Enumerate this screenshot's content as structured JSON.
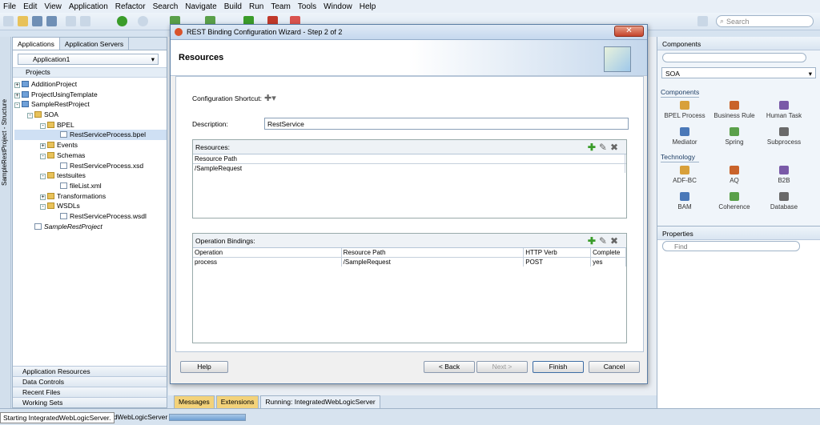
{
  "menu": [
    "File",
    "Edit",
    "View",
    "Application",
    "Refactor",
    "Search",
    "Navigate",
    "Build",
    "Run",
    "Team",
    "Tools",
    "Window",
    "Help"
  ],
  "search": {
    "placeholder": "Search"
  },
  "left_strip": {
    "label": "SampleRestProject - Structure"
  },
  "nav": {
    "tabs": [
      "Applications",
      "Application Servers"
    ],
    "app_selector": "Application1",
    "projects_label": "Projects",
    "tree": [
      {
        "label": "AdditionProject",
        "indent": 0,
        "type": "proj",
        "exp": "+"
      },
      {
        "label": "ProjectUsingTemplate",
        "indent": 0,
        "type": "proj",
        "exp": "+"
      },
      {
        "label": "SampleRestProject",
        "indent": 0,
        "type": "proj",
        "exp": "-"
      },
      {
        "label": "SOA",
        "indent": 1,
        "type": "folder",
        "exp": "-"
      },
      {
        "label": "BPEL",
        "indent": 2,
        "type": "folder",
        "exp": "-"
      },
      {
        "label": "RestServiceProcess.bpel",
        "indent": 3,
        "type": "file",
        "exp": "",
        "selected": true
      },
      {
        "label": "Events",
        "indent": 2,
        "type": "folder",
        "exp": "+"
      },
      {
        "label": "Schemas",
        "indent": 2,
        "type": "folder",
        "exp": "-"
      },
      {
        "label": "RestServiceProcess.xsd",
        "indent": 3,
        "type": "file",
        "exp": ""
      },
      {
        "label": "testsuites",
        "indent": 2,
        "type": "folder",
        "exp": "-"
      },
      {
        "label": "fileList.xml",
        "indent": 3,
        "type": "file",
        "exp": ""
      },
      {
        "label": "Transformations",
        "indent": 2,
        "type": "folder",
        "exp": "+"
      },
      {
        "label": "WSDLs",
        "indent": 2,
        "type": "folder",
        "exp": "-"
      },
      {
        "label": "RestServiceProcess.wsdl",
        "indent": 3,
        "type": "file",
        "exp": ""
      },
      {
        "label": "SampleRestProject",
        "indent": 1,
        "type": "file",
        "exp": "",
        "italic": true
      }
    ],
    "accordions": [
      "Application Resources",
      "Data Controls",
      "Recent Files",
      "Working Sets"
    ]
  },
  "dialog": {
    "title": "REST Binding Configuration Wizard - Step 2 of 2",
    "header": "Resources",
    "config_shortcut_label": "Configuration Shortcut:",
    "description_label": "Description:",
    "description_value": "RestService",
    "resources": {
      "title": "Resources:",
      "columns": [
        "Resource Path"
      ],
      "rows": [
        [
          "/SampleRequest"
        ]
      ]
    },
    "operations": {
      "title": "Operation Bindings:",
      "columns": [
        "Operation",
        "Resource Path",
        "HTTP Verb",
        "Complete"
      ],
      "rows": [
        [
          "process",
          "/SampleRequest",
          "POST",
          "yes"
        ]
      ]
    },
    "buttons": {
      "help": "Help",
      "back": "< Back",
      "next": "Next >",
      "finish": "Finish",
      "cancel": "Cancel"
    }
  },
  "bottom_tabs": [
    "Messages",
    "Extensions",
    "Running: IntegratedWebLogicServer"
  ],
  "status": {
    "message": "Starting IntegratedWebLogicServer.",
    "trailing": "atedWebLogicServer"
  },
  "components": {
    "title": "Components",
    "palette": "SOA",
    "section1": "Components",
    "items1": [
      "BPEL Process",
      "Business Rule",
      "Human Task",
      "Mediator",
      "Spring",
      "Subprocess"
    ],
    "section2": "Technology",
    "items2": [
      "ADF-BC",
      "AQ",
      "B2B",
      "BAM",
      "Coherence",
      "Database"
    ]
  },
  "properties": {
    "title": "Properties",
    "find_placeholder": "Find"
  }
}
